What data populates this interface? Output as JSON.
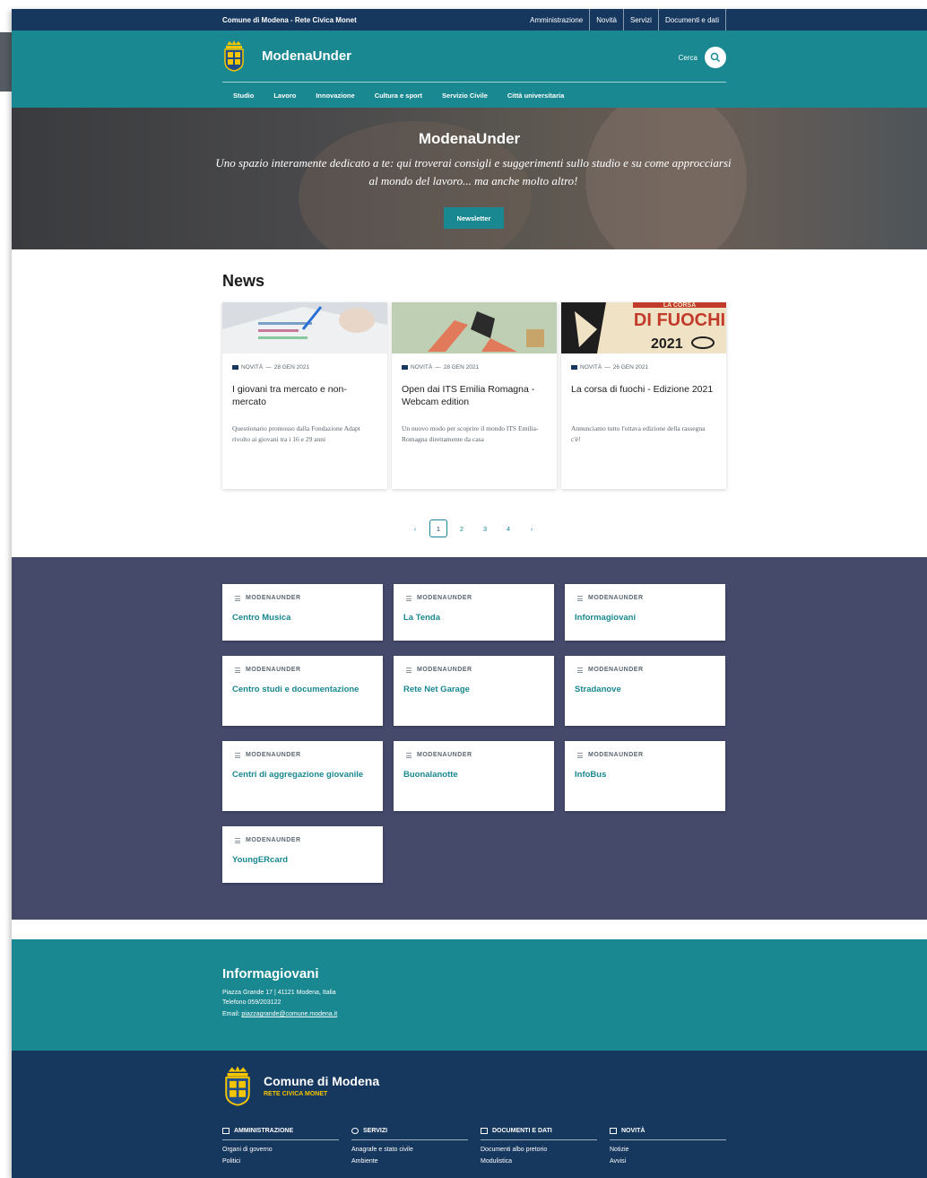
{
  "topbar": {
    "org": "Comune di Modena - Rete Civica Monet",
    "links": [
      "Amministrazione",
      "Novità",
      "Servizi",
      "Documenti e dati"
    ]
  },
  "header": {
    "site_name": "ModenaUnder",
    "search_label": "Cerca",
    "nav": [
      "Studio",
      "Lavoro",
      "Innovazione",
      "Cultura e sport",
      "Servizio Civile",
      "Città universitaria"
    ]
  },
  "hero": {
    "title": "ModenaUnder",
    "subtitle": "Uno spazio interamente dedicato a te: qui troverai consigli e suggerimenti sullo studio e su come approcciarsi al mondo del lavoro... ma anche molto altro!",
    "button": "Newsletter"
  },
  "news": {
    "title": "News",
    "items": [
      {
        "category": "NOVITÀ",
        "date": "28 GEN 2021",
        "title": "I giovani tra mercato e non-mercato",
        "text": "Questionario promosso dalla Fondazione Adapt rivolto ai giovani tra i 16 e 29 anni"
      },
      {
        "category": "NOVITÀ",
        "date": "28 GEN 2021",
        "title": "Open dai ITS Emilia Romagna - Webcam edition",
        "text": "Un nuovo modo per scoprire il mondo ITS Emilia-Romagna direttamente da casa"
      },
      {
        "category": "NOVITÀ",
        "date": "26 GEN 2021",
        "title": "La corsa di fuochi - Edizione 2021",
        "text": "Annunciamo tutto l'ottava edizione della rassegna c'è!",
        "image_text": [
          "LA CORSA",
          "DI FUOCHI",
          "2021"
        ]
      }
    ],
    "separator": "—"
  },
  "pager": {
    "prev": "‹",
    "pages": [
      "1",
      "2",
      "3",
      "4"
    ],
    "next": "›",
    "current": "1"
  },
  "sites": {
    "kicker": "MODENAUNDER",
    "items": [
      "Centro Musica",
      "La Tenda",
      "Informagiovani",
      "Centro studi e documentazione",
      "Rete Net Garage",
      "Stradanove",
      "Centri di aggregazione giovanile",
      "Buonalanotte",
      "InfoBus",
      "YoungERcard"
    ]
  },
  "info": {
    "title": "Informagiovani",
    "address": "Piazza Grande 17 | 41121 Modena, Italia",
    "phone": "Telefono 059/203122",
    "email_label": "Email:",
    "email": "piazzagrande@comune.modena.it"
  },
  "footer": {
    "name": "Comune di Modena",
    "sub": "RETE CIVICA MONET",
    "columns": [
      {
        "head": "AMMINISTRAZIONE",
        "links": [
          "Organi di governo",
          "Politici"
        ]
      },
      {
        "head": "SERVIZI",
        "links": [
          "Anagrafe e stato civile",
          "Ambiente"
        ]
      },
      {
        "head": "DOCUMENTI E DATI",
        "links": [
          "Documenti albo pretorio",
          "Modulistica"
        ]
      },
      {
        "head": "NOVITÀ",
        "links": [
          "Notizie",
          "Avvisi"
        ]
      }
    ]
  },
  "colors": {
    "topbar": "#16375e",
    "primary": "#198891",
    "sites_bg": "#454a6b",
    "footer_bg": "#16375e"
  }
}
